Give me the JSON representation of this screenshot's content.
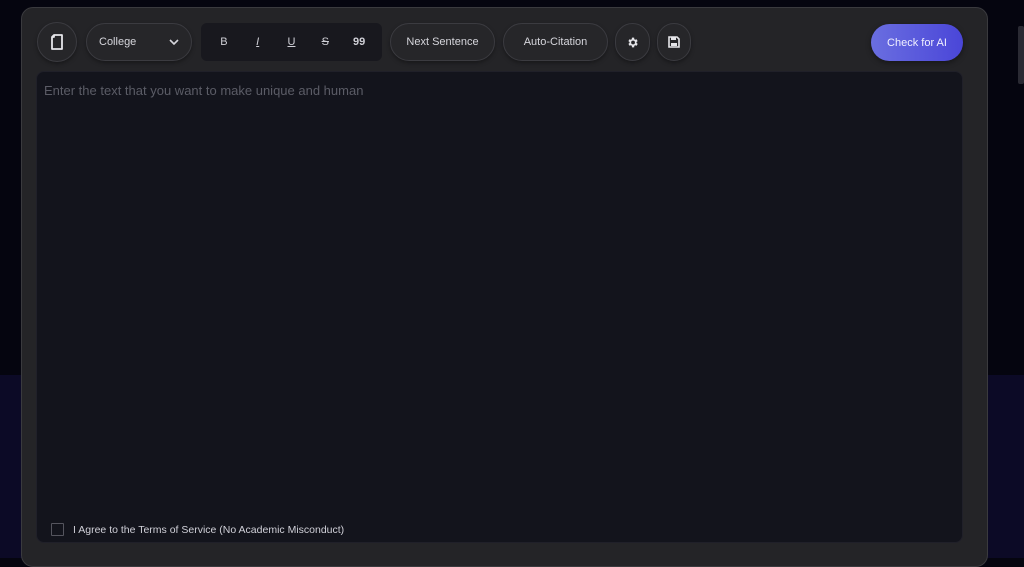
{
  "toolbar": {
    "document_icon": "document-icon",
    "level_select": {
      "value": "College",
      "icon": "chevron-down-icon"
    },
    "format": {
      "bold": "B",
      "italic": "I",
      "underline": "U",
      "strikethrough": "S",
      "quote": "99"
    },
    "next_sentence_label": "Next Sentence",
    "auto_citation_label": "Auto-Citation",
    "settings_icon": "gear-icon",
    "save_icon": "save-icon",
    "check_ai_label": "Check for AI"
  },
  "editor": {
    "placeholder": "Enter the text that you want to make unique and human",
    "value": ""
  },
  "terms": {
    "label": "I Agree to the Terms of Service (No Academic Misconduct)",
    "checked": false
  },
  "colors": {
    "accent_start": "#6a6ee0",
    "accent_end": "#4a46d8",
    "panel": "#242427",
    "editor": "#13141c"
  }
}
